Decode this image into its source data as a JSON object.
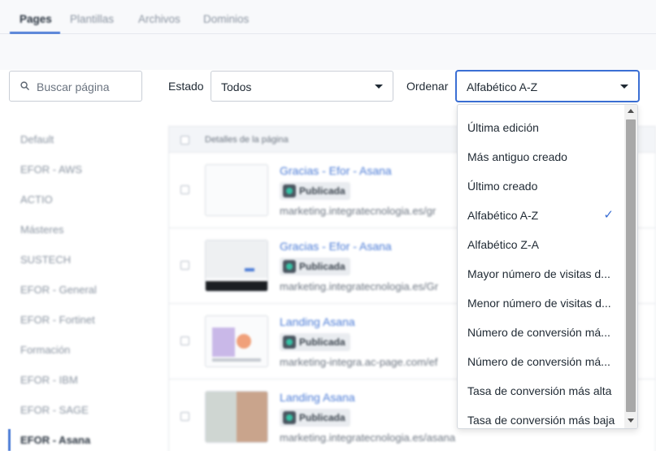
{
  "tabs": [
    "Pages",
    "Plantillas",
    "Archivos",
    "Dominios"
  ],
  "search": {
    "placeholder": "Buscar página"
  },
  "filters": {
    "estado_label": "Estado",
    "estado_value": "Todos",
    "ordenar_label": "Ordenar",
    "ordenar_value": "Alfabético A-Z"
  },
  "sort_options": [
    {
      "label": "Última edición",
      "selected": false
    },
    {
      "label": "Más antiguo creado",
      "selected": false
    },
    {
      "label": "Último creado",
      "selected": false
    },
    {
      "label": "Alfabético A-Z",
      "selected": true
    },
    {
      "label": "Alfabético Z-A",
      "selected": false
    },
    {
      "label": "Mayor número de visitas d...",
      "selected": false
    },
    {
      "label": "Menor número de visitas d...",
      "selected": false
    },
    {
      "label": "Número de conversión má...",
      "selected": false
    },
    {
      "label": "Número de conversión má...",
      "selected": false
    },
    {
      "label": "Tasa de conversión más alta",
      "selected": false
    },
    {
      "label": "Tasa de conversión más baja",
      "selected": false
    }
  ],
  "check_icon": "✓",
  "sidebar": {
    "items": [
      "Default",
      "EFOR - AWS",
      "ACTIO",
      "Másteres",
      "SUSTECH",
      "EFOR - General",
      "EFOR - Fortinet",
      "Formación",
      "EFOR - IBM",
      "EFOR - SAGE",
      "EFOR - Asana"
    ],
    "active_index": 10
  },
  "table": {
    "header": "Detalles de la página",
    "rows": [
      {
        "title": "Gracias - Efor - Asana",
        "status": "Publicada",
        "url": "marketing.integratecnologia.es/gr"
      },
      {
        "title": "Gracias - Efor - Asana",
        "status": "Publicada",
        "url": "marketing.integratecnologia.es/Gr"
      },
      {
        "title": "Landing Asana",
        "status": "Publicada",
        "url": "marketing-integra.ac-page.com/ef"
      },
      {
        "title": "Landing Asana",
        "status": "Publicada",
        "url": "marketing.integratecnologia.es/asana"
      }
    ]
  },
  "colors": {
    "accent": "#3b6fd4",
    "link": "#4b7bd6",
    "status_dot": "#36c2a5"
  }
}
